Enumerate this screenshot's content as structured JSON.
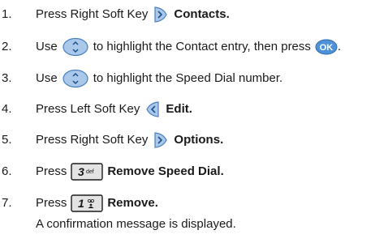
{
  "steps": [
    {
      "num": "1.",
      "pre": "Press Right Soft Key",
      "icon": "right-soft-key-icon",
      "bold": "Contacts."
    },
    {
      "num": "2.",
      "pre": "Use",
      "icon": "nav-key-icon",
      "mid": "to highlight the Contact entry, then press",
      "icon2": "ok-key-icon",
      "post": "."
    },
    {
      "num": "3.",
      "pre": "Use",
      "icon": "nav-key-icon",
      "mid": "to highlight the Speed Dial number."
    },
    {
      "num": "4.",
      "pre": "Press Left Soft Key",
      "icon": "left-soft-key-icon",
      "bold": "Edit."
    },
    {
      "num": "5.",
      "pre": "Press Right Soft Key",
      "icon": "right-soft-key-icon",
      "bold": "Options."
    },
    {
      "num": "6.",
      "pre": "Press",
      "icon": "key-3-def-icon",
      "key_main": "3",
      "key_sub": "def",
      "bold": "Remove Speed Dial."
    },
    {
      "num": "7.",
      "pre": "Press",
      "icon": "key-1-voicemail-icon",
      "key_main": "1",
      "bold": "Remove.",
      "note": "A confirmation message is displayed."
    }
  ],
  "colors": {
    "text": "#1a1a1a",
    "icon_fill": "#a9c8ea",
    "icon_stroke": "#4a7fbf",
    "ok_fill": "#4f92d8",
    "key_fill": "#e3e3e3"
  }
}
